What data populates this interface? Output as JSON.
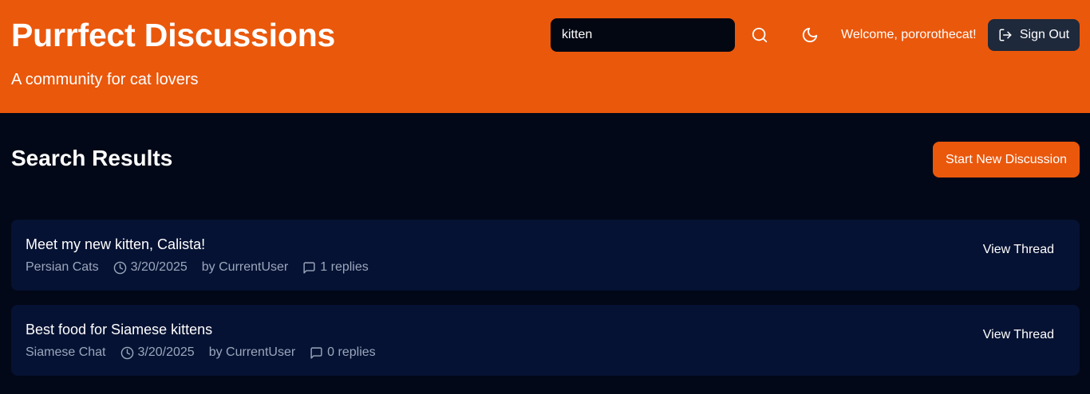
{
  "header": {
    "title": "Purrfect Discussions",
    "tagline": "A community for cat lovers",
    "search_value": "kitten",
    "search_icon": "search-icon",
    "theme_icon": "moon-icon",
    "welcome": "Welcome, pororothecat!",
    "signout_label": "Sign Out",
    "signout_icon": "log-out-icon"
  },
  "main": {
    "heading": "Search Results",
    "new_discussion_label": "Start New Discussion"
  },
  "results": [
    {
      "title": "Meet my new kitten, Calista!",
      "category": "Persian Cats",
      "date": "3/20/2025",
      "author": "by CurrentUser",
      "replies": "1 replies",
      "action": "View Thread"
    },
    {
      "title": "Best food for Siamese kittens",
      "category": "Siamese Chat",
      "date": "3/20/2025",
      "author": "by CurrentUser",
      "replies": "0 replies",
      "action": "View Thread"
    }
  ],
  "colors": {
    "accent": "#ea580c",
    "background": "#020817",
    "card": "#061233",
    "muted_text": "#9aa7bd"
  }
}
